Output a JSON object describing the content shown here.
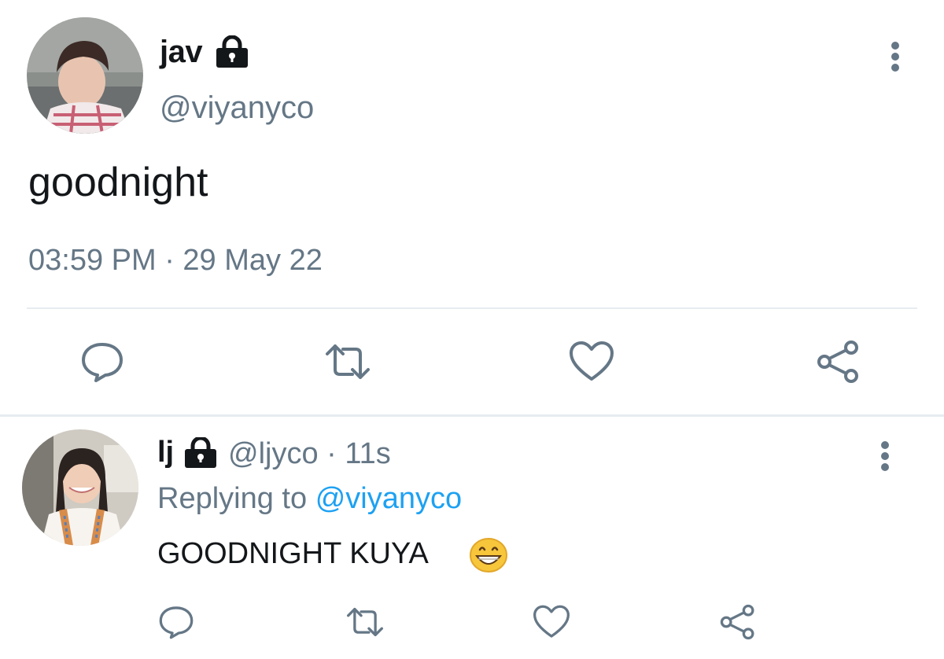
{
  "main_tweet": {
    "display_name": "jav",
    "handle": "@viyanyco",
    "text": "goodnight",
    "timestamp": "03:59 PM · 29 May 22",
    "protected_icon": "lock-icon",
    "menu_icon": "more-vertical-icon",
    "actions": [
      "reply-icon",
      "retweet-icon",
      "like-icon",
      "share-icon"
    ]
  },
  "reply_tweet": {
    "display_name": "lj",
    "handle_time": "@ljyco · 11s",
    "replying_prefix": "Replying to",
    "replying_target": "@viyanyco",
    "text": "GOODNIGHT KUYA",
    "emoji": "grinning-face-emoji",
    "protected_icon": "lock-icon",
    "menu_icon": "more-vertical-icon",
    "actions": [
      "reply-icon",
      "retweet-icon",
      "like-icon",
      "share-icon"
    ]
  },
  "colors": {
    "text_primary": "#14171a",
    "text_secondary": "#657786",
    "link": "#1da1f2",
    "icon": "#657786",
    "divider": "#e6ecf0"
  }
}
